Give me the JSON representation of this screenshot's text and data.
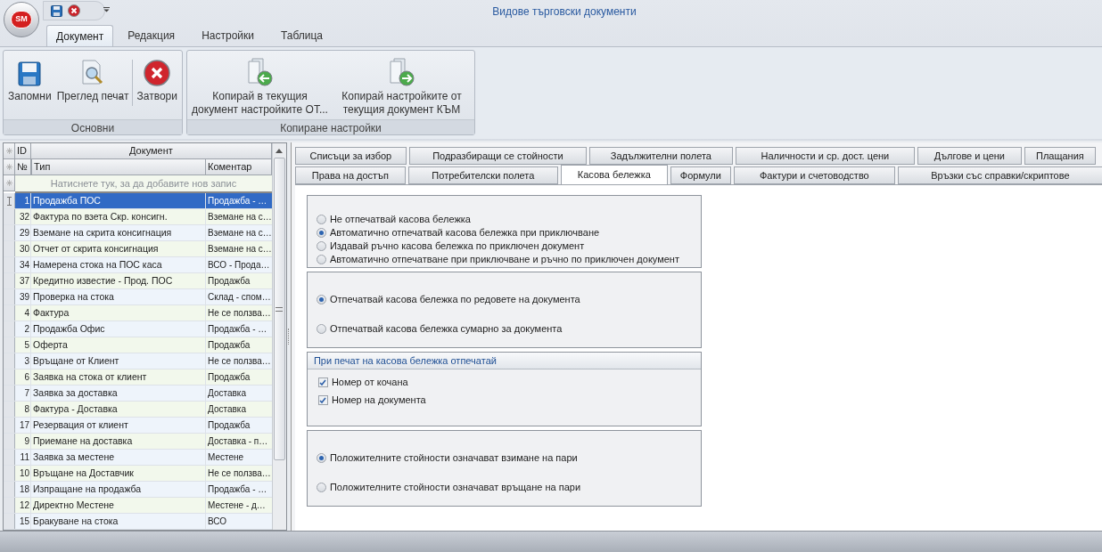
{
  "window": {
    "title": "Видове търговски документи",
    "logo": "SM"
  },
  "ribbon": {
    "tabs": [
      {
        "label": "Документ",
        "selected": true
      },
      {
        "label": "Редакция",
        "selected": false
      },
      {
        "label": "Настройки",
        "selected": false
      },
      {
        "label": "Таблица",
        "selected": false
      }
    ],
    "groups": [
      {
        "caption": "Основни",
        "buttons": [
          {
            "kind": "save",
            "label": "Запомни"
          },
          {
            "kind": "preview",
            "label": "Преглед печат",
            "dropdown": true
          },
          {
            "kind": "separator"
          },
          {
            "kind": "close",
            "label": "Затвори"
          }
        ]
      },
      {
        "caption": "Копиране настройки",
        "buttons": [
          {
            "kind": "copy-from",
            "label": "Копирай в текущия документ настройките ОТ..."
          },
          {
            "kind": "copy-to",
            "label": "Копирай настройките от текущия документ КЪМ"
          }
        ]
      }
    ]
  },
  "grid": {
    "band": "Документ",
    "columns": [
      {
        "id": "ID"
      },
      {
        "id": "№",
        "type": "Тип",
        "comment": "Коментар"
      }
    ],
    "new_row": "Натиснете тук, за да добавите нов запис",
    "rows": [
      {
        "id": "1",
        "type": "Продажба ПОС",
        "comment": "Продажба - …",
        "selected": true
      },
      {
        "id": "32",
        "type": "Фактура по взета Скр. консигн.",
        "comment": "Вземане на с…",
        "selected": false
      },
      {
        "id": "29",
        "type": "Вземане на скрита консигнация",
        "comment": "Вземане на с…",
        "selected": false
      },
      {
        "id": "30",
        "type": "Отчет от скрита консигнация",
        "comment": "Вземане на с…",
        "selected": false
      },
      {
        "id": "34",
        "type": "Намерена стока на ПОС каса",
        "comment": "ВСО - Прода…",
        "selected": false
      },
      {
        "id": "37",
        "type": "Кредитно известие - Прод.  ПОС",
        "comment": "Продажба",
        "selected": false
      },
      {
        "id": "39",
        "type": "Проверка на стока",
        "comment": "Склад - спом…",
        "selected": false
      },
      {
        "id": "4",
        "type": "Фактура",
        "comment": "Не се ползва…",
        "selected": false
      },
      {
        "id": "2",
        "type": "Продажба Офис",
        "comment": "Продажба - …",
        "selected": false
      },
      {
        "id": "5",
        "type": "Оферта",
        "comment": "Продажба",
        "selected": false
      },
      {
        "id": "3",
        "type": "Връщане от Клиент",
        "comment": "Не се ползва…",
        "selected": false
      },
      {
        "id": "6",
        "type": "Заявка на стока от клиент",
        "comment": "Продажба",
        "selected": false
      },
      {
        "id": "7",
        "type": "Заявка за доставка",
        "comment": "Доставка",
        "selected": false
      },
      {
        "id": "8",
        "type": "Фактура - Доставка",
        "comment": "Доставка",
        "selected": false
      },
      {
        "id": "17",
        "type": "Резервация от клиент",
        "comment": "Продажба",
        "selected": false
      },
      {
        "id": "9",
        "type": "Приемане на доставка",
        "comment": "Доставка - п…",
        "selected": false
      },
      {
        "id": "11",
        "type": "Заявка за местене",
        "comment": "Местене",
        "selected": false
      },
      {
        "id": "10",
        "type": "Връщане на Доставчик",
        "comment": "Не се ползва…",
        "selected": false
      },
      {
        "id": "18",
        "type": "Изпращане на продажба",
        "comment": "Продажба - …",
        "selected": false
      },
      {
        "id": "12",
        "type": "Директно Местене",
        "comment": "Местене - д…",
        "selected": false
      },
      {
        "id": "15",
        "type": "Бракуване на стока",
        "comment": "ВСО",
        "selected": false
      }
    ]
  },
  "tabs": [
    [
      {
        "label": "Списъци за избор",
        "selected": false
      },
      {
        "label": "Подразбиращи се стойности",
        "selected": false
      },
      {
        "label": "Задължителни полета",
        "selected": false
      },
      {
        "label": "Наличности и ср. дост. цени",
        "selected": false
      },
      {
        "label": "Дългове и цени",
        "selected": false
      },
      {
        "label": "Плащания",
        "selected": false
      }
    ],
    [
      {
        "label": "Права на достъп",
        "selected": false
      },
      {
        "label": "Потребителски полета",
        "selected": false
      },
      {
        "label": "Касова бележка",
        "selected": true
      },
      {
        "label": "Формули",
        "selected": false
      },
      {
        "label": "Фактури и счетоводство",
        "selected": false
      },
      {
        "label": "Връзки със справки/скриптове",
        "selected": false
      }
    ]
  ],
  "groups": [
    {
      "kind": "radio",
      "spread": false,
      "options": [
        {
          "label": "Не отпечатвай касова бележка",
          "selected": false
        },
        {
          "label": "Автоматично отпечатвай касова бележка при приключване",
          "selected": true
        },
        {
          "label": "Издавай ръчно касова бележка по приключен документ",
          "selected": false
        },
        {
          "label": "Автоматично отпечатване при приключване и ръчно по приключен документ",
          "selected": false
        }
      ]
    },
    {
      "kind": "radio",
      "spread": true,
      "options": [
        {
          "label": "Отпечатвай касова бележка по редовете на документа",
          "selected": true
        },
        {
          "label": "Отпечатвай касова бележка сумарно за документа",
          "selected": false
        }
      ]
    },
    {
      "kind": "checkbox",
      "title": "При печат на касова бележка отпечатай",
      "options": [
        {
          "label": "Номер от кочана",
          "checked": true
        },
        {
          "label": "Номер на документа",
          "checked": true
        }
      ]
    },
    {
      "kind": "radio",
      "spread": true,
      "options": [
        {
          "label": "Положителните стойности означават взимане на пари",
          "selected": true
        },
        {
          "label": "Положителните стойности означават връщане на пари",
          "selected": false
        }
      ]
    }
  ]
}
